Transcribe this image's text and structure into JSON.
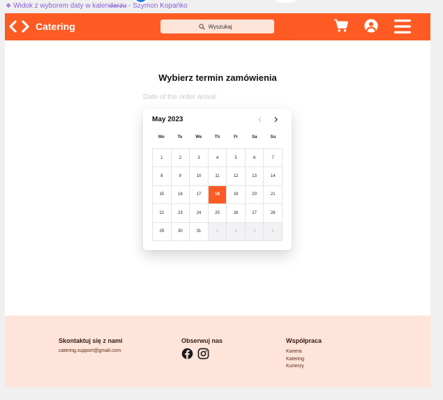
{
  "frame_label": {
    "prefix": "❖",
    "part1": "Widok z wyborem daty w kalen",
    "strike": "darzu",
    "part2": " - Szymon Kopańko"
  },
  "navbar": {
    "brand": "Catering",
    "search_placeholder": "Wyszukaj",
    "icons": [
      "back-arrow-icon",
      "forward-arrow-icon",
      "search-icon",
      "cart-icon",
      "user-icon",
      "menu-icon"
    ],
    "accent_color": "#fe5b24"
  },
  "main": {
    "title": "Wybierz termin zamówienia",
    "date_placeholder": "Date of the order arrival"
  },
  "calendar": {
    "month_label": "May 2023",
    "weekdays": [
      "Mo",
      "Tu",
      "We",
      "Th",
      "Fr",
      "Sa",
      "Su"
    ],
    "days": [
      {
        "n": "1",
        "o": false
      },
      {
        "n": "2",
        "o": false
      },
      {
        "n": "3",
        "o": false
      },
      {
        "n": "4",
        "o": false
      },
      {
        "n": "5",
        "o": false
      },
      {
        "n": "6",
        "o": false
      },
      {
        "n": "7",
        "o": false
      },
      {
        "n": "8",
        "o": false
      },
      {
        "n": "9",
        "o": false
      },
      {
        "n": "10",
        "o": false
      },
      {
        "n": "11",
        "o": false
      },
      {
        "n": "12",
        "o": false
      },
      {
        "n": "13",
        "o": false
      },
      {
        "n": "14",
        "o": false
      },
      {
        "n": "15",
        "o": false
      },
      {
        "n": "16",
        "o": false
      },
      {
        "n": "17",
        "o": false
      },
      {
        "n": "18",
        "o": false
      },
      {
        "n": "19",
        "o": false
      },
      {
        "n": "20",
        "o": false
      },
      {
        "n": "21",
        "o": false
      },
      {
        "n": "22",
        "o": false
      },
      {
        "n": "23",
        "o": false
      },
      {
        "n": "24",
        "o": false
      },
      {
        "n": "25",
        "o": false
      },
      {
        "n": "26",
        "o": false
      },
      {
        "n": "27",
        "o": false
      },
      {
        "n": "28",
        "o": false
      },
      {
        "n": "29",
        "o": false
      },
      {
        "n": "30",
        "o": false
      },
      {
        "n": "31",
        "o": false
      },
      {
        "n": "1",
        "o": true
      },
      {
        "n": "2",
        "o": true
      },
      {
        "n": "3",
        "o": true
      },
      {
        "n": "4",
        "o": true
      }
    ],
    "selected_day": "18"
  },
  "footer": {
    "contact": {
      "heading": "Skontaktuj się z nami",
      "email": "catering.support@gmail.com"
    },
    "follow": {
      "heading": "Obserwuj nas",
      "icons": [
        "facebook-icon",
        "instagram-icon"
      ]
    },
    "cooperation": {
      "heading": "Współpraca",
      "links": [
        "Kariera",
        "Katering",
        "Kurierzy"
      ]
    }
  }
}
